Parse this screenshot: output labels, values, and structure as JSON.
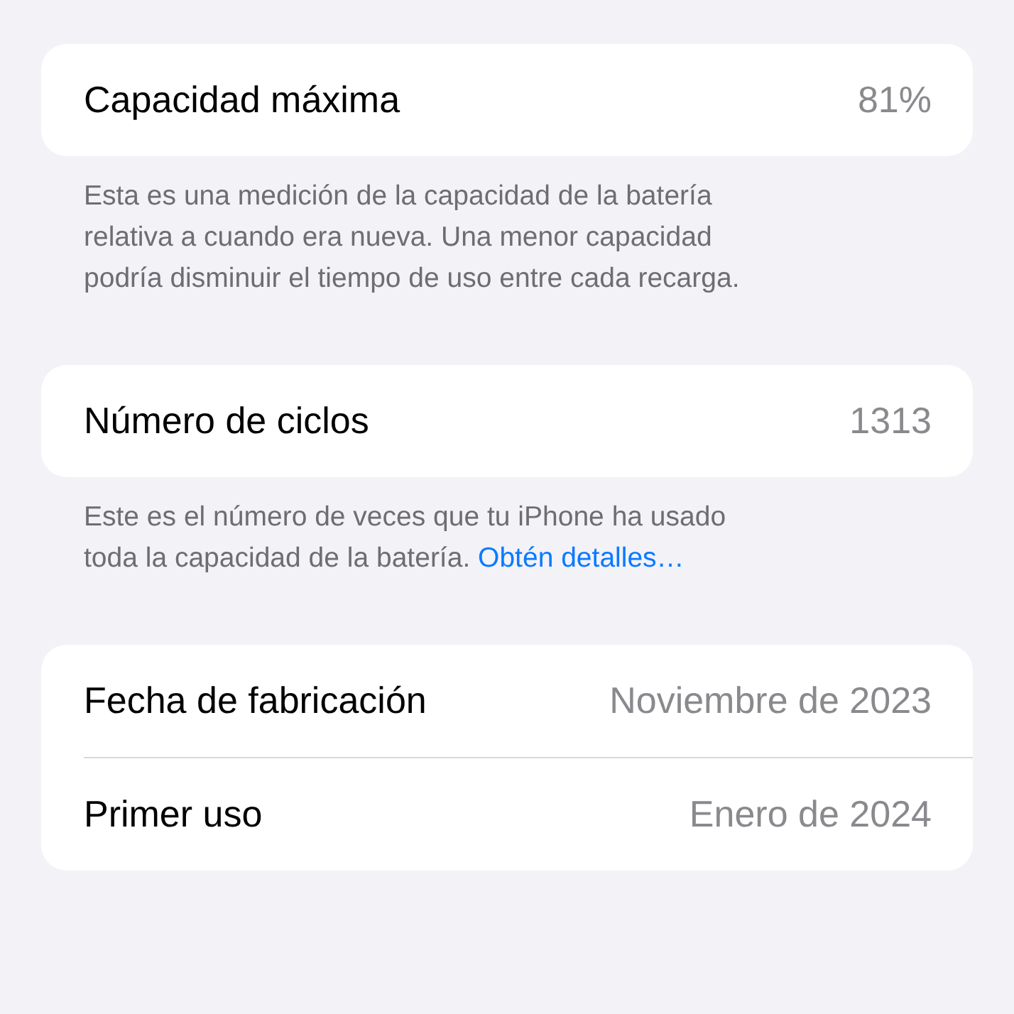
{
  "sections": [
    {
      "rows": [
        {
          "label": "Capacidad máxima",
          "value": "81%"
        }
      ],
      "footer": {
        "text": "Esta es una medición de la capacidad de la batería\nrelativa a cuando era nueva. Una menor capacidad\npodría disminuir el tiempo de uso entre cada recarga."
      }
    },
    {
      "rows": [
        {
          "label": "Número de ciclos",
          "value": "1313"
        }
      ],
      "footer": {
        "text": "Este es el número de veces que tu iPhone ha usado\ntoda la capacidad de la batería. ",
        "link": "Obtén detalles…"
      }
    },
    {
      "rows": [
        {
          "label": "Fecha de fabricación",
          "value": "Noviembre de 2023"
        },
        {
          "label": "Primer uso",
          "value": "Enero de 2024"
        }
      ]
    }
  ]
}
